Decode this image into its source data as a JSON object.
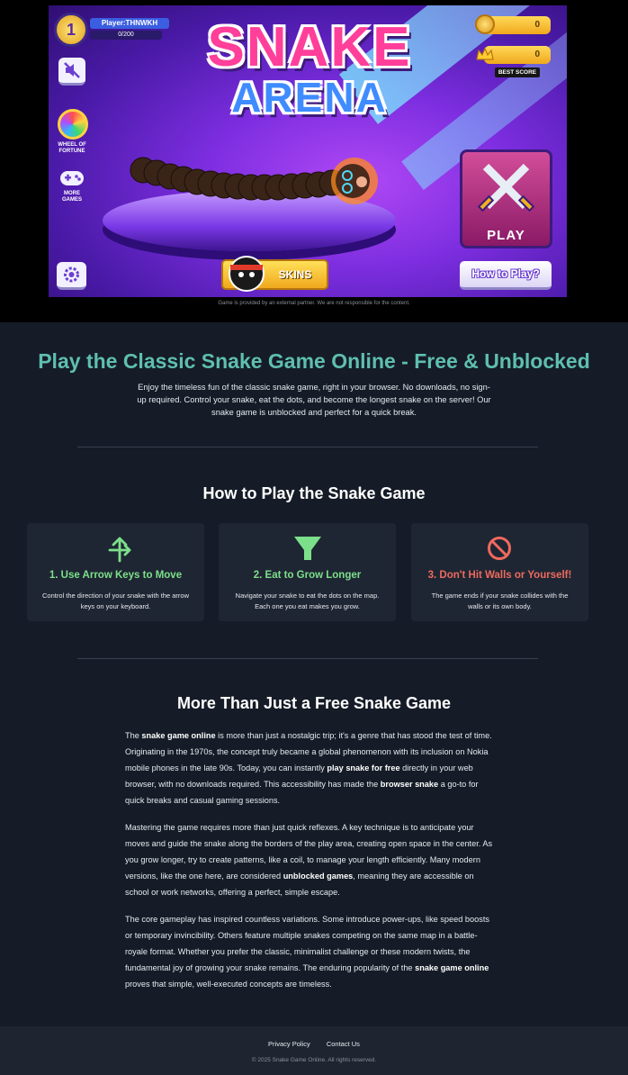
{
  "game": {
    "player_level": "1",
    "player_name": "Player:THNWKH",
    "xp": "0/200",
    "coins": "0",
    "best_score": "0",
    "best_score_label": "BEST SCORE",
    "logo_line1": "SNAKE",
    "logo_line2": "ARENA",
    "wheel_label": "WHEEL OF FORTUNE",
    "more_games_label": "MORE GAMES",
    "play_label": "PLAY",
    "skins_label": "SKINS",
    "how_to_label": "How to Play?",
    "notice": "Game is provided by an external partner. We are not responsible for the content."
  },
  "hero": {
    "title": "Play the Classic Snake Game Online - Free & Unblocked",
    "intro": "Enjoy the timeless fun of the classic snake game, right in your browser. No downloads, no sign-up required. Control your snake, eat the dots, and become the longest snake on the server! Our snake game is unblocked and perfect for a quick break."
  },
  "how_to": {
    "heading": "How to Play the Snake Game",
    "cards": [
      {
        "title": "1. Use Arrow Keys to Move",
        "desc": "Control the direction of your snake with the arrow keys on your keyboard.",
        "color": "#7ce08a",
        "icon": "arrow-keys-icon"
      },
      {
        "title": "2. Eat to Grow Longer",
        "desc": "Navigate your snake to eat the dots on the map. Each one you eat makes you grow.",
        "color": "#7ce08a",
        "icon": "funnel-icon"
      },
      {
        "title": "3. Don't Hit Walls or Yourself!",
        "desc": "The game ends if your snake collides with the walls or its own body.",
        "color": "#ef6a5e",
        "icon": "ban-icon"
      }
    ]
  },
  "more": {
    "heading": "More Than Just a Free Snake Game",
    "p1": {
      "a": "The ",
      "b1": "snake game online",
      "c": " is more than just a nostalgic trip; it's a genre that has stood the test of time. Originating in the 1970s, the concept truly became a global phenomenon with its inclusion on Nokia mobile phones in the late 90s. Today, you can instantly ",
      "b2": "play snake for free",
      "d": " directly in your web browser, with no downloads required. This accessibility has made the ",
      "b3": "browser snake",
      "e": " a go-to for quick breaks and casual gaming sessions."
    },
    "p2": {
      "a": "Mastering the game requires more than just quick reflexes. A key technique is to anticipate your moves and guide the snake along the borders of the play area, creating open space in the center. As you grow longer, try to create patterns, like a coil, to manage your length efficiently. Many modern versions, like the one here, are considered ",
      "b1": "unblocked games",
      "c": ", meaning they are accessible on school or work networks, offering a perfect, simple escape."
    },
    "p3": {
      "a": "The core gameplay has inspired countless variations. Some introduce power-ups, like speed boosts or temporary invincibility. Others feature multiple snakes competing on the same map in a battle-royale format. Whether you prefer the classic, minimalist challenge or these modern twists, the fundamental joy of growing your snake remains. The enduring popularity of the ",
      "b1": "snake game online",
      "c": " proves that simple, well-executed concepts are timeless."
    }
  },
  "footer": {
    "privacy": "Privacy Policy",
    "contact": "Contact Us",
    "copyright": "© 2025 Snake Game Online. All rights reserved."
  }
}
